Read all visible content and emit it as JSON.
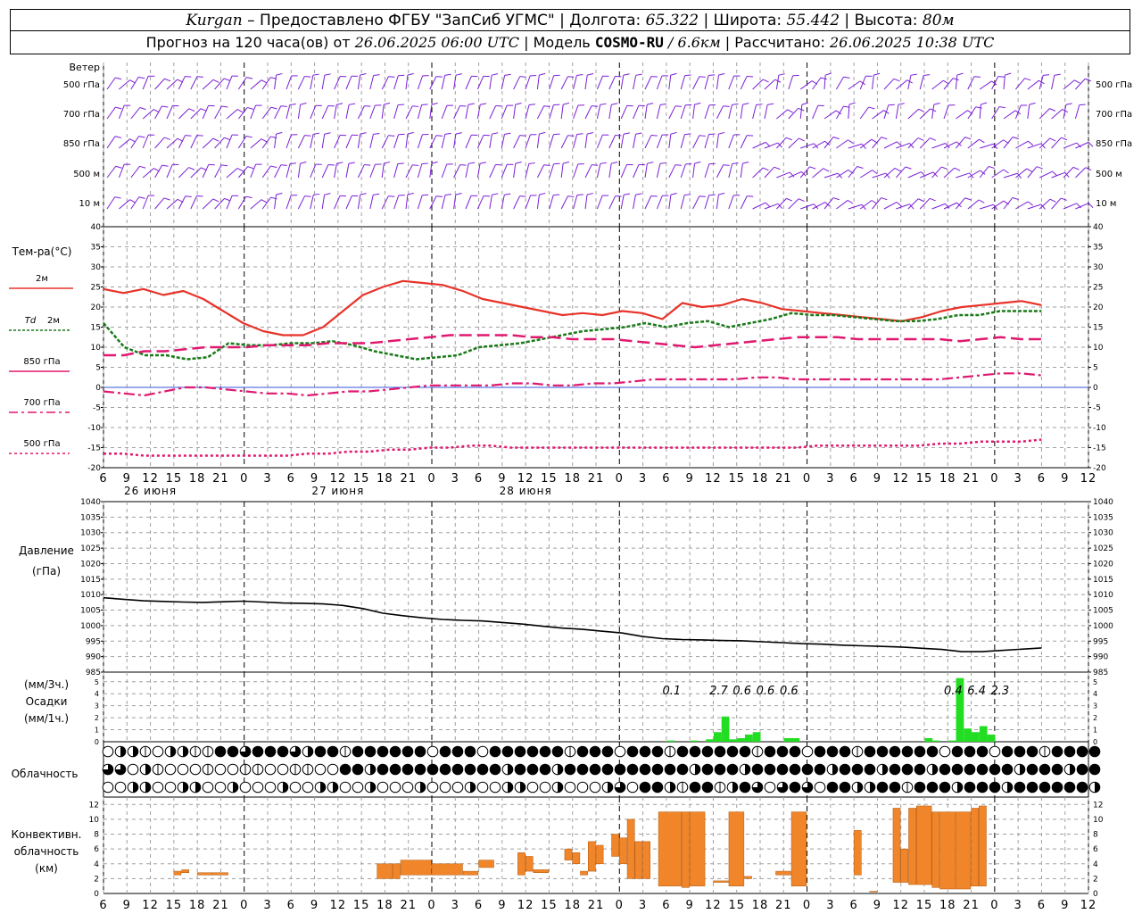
{
  "header": {
    "station": "Kurgan",
    "provider": "– Предоставлено ФГБУ \"ЗапСиб УГМС\"",
    "lon_label": "Долгота:",
    "lon": "65.322",
    "lat_label": "Широта:",
    "lat": "55.442",
    "alt_label": "Высота:",
    "alt": "80м",
    "forecast_prefix": "Прогноз на 120 часа(ов) от",
    "forecast_from": "26.06.2025 06:00 UTC",
    "model_label": "Модель",
    "model": "COSMO-RU",
    "resolution": "/ 6.6км",
    "computed_label": "Рассчитано:",
    "computed": "26.06.2025 10:38 UTC"
  },
  "labels": {
    "wind": "Ветер",
    "wind_levels": [
      "500 гПа",
      "700 гПа",
      "850 гПа",
      "500 м",
      "10 м"
    ],
    "temp": "Тем-ра(°С)",
    "temp_2m": "2м",
    "td_a": "Td",
    "td_b": "2м",
    "t850": "850 гПа",
    "t700": "700 гПа",
    "t500": "500 гПа",
    "pressure": "Давление",
    "pressure_unit": "(гПа)",
    "precip_unit3": "(мм/3ч.)",
    "precip": "Осадки",
    "precip_unit1": "(мм/1ч.)",
    "cloud": "Облачность",
    "conv1": "Конвективн.",
    "conv2": "облачность",
    "conv3": "(км)"
  },
  "colors": {
    "t2m": "#e8332a",
    "td2m": "#1a7a1a",
    "t_upper": "#e0186f",
    "wind": "#7b1fd6",
    "precip": "#22dd22",
    "conv": "#f0852a",
    "pressure": "#000000"
  },
  "chart_data": {
    "type": "line",
    "x_hours": [
      0,
      3,
      6,
      9,
      12,
      15,
      18,
      21,
      24,
      27,
      30,
      33,
      36,
      39,
      42,
      45,
      48,
      51,
      54,
      57,
      60,
      63,
      66,
      69,
      72,
      75,
      78,
      81,
      84,
      87,
      90,
      93,
      96,
      99,
      102,
      105,
      108,
      111,
      114,
      117,
      120
    ],
    "x_tick_labels": [
      "6",
      "9",
      "12",
      "15",
      "18",
      "21",
      "0",
      "3",
      "6",
      "9",
      "12",
      "15",
      "18",
      "21",
      "0",
      "3",
      "6",
      "9",
      "12",
      "15",
      "18",
      "21",
      "0",
      "3",
      "6",
      "9",
      "12",
      "15",
      "18",
      "21",
      "0",
      "3",
      "6",
      "9",
      "12",
      "15",
      "18",
      "21",
      "0",
      "3",
      "6",
      "9",
      "12"
    ],
    "day_labels": [
      {
        "hour": 6,
        "label": "26 июня"
      },
      {
        "hour": 30,
        "label": "27 июня"
      },
      {
        "hour": 54,
        "label": "28 июня"
      }
    ],
    "temperature": {
      "ylim": [
        -20,
        40
      ],
      "ticks": [
        "40",
        "35",
        "30",
        "25",
        "20",
        "15",
        "10",
        "5",
        "0",
        "-5",
        "-10",
        "-15",
        "-20"
      ],
      "series": [
        {
          "name": "2м",
          "values": [
            24.5,
            23.5,
            24.5,
            23,
            24,
            22,
            19,
            16,
            14,
            13,
            13,
            15,
            19,
            23,
            25,
            26.5,
            26,
            25.5,
            24,
            22,
            21,
            20,
            19,
            18,
            18.5,
            18,
            19,
            18.5,
            17,
            21,
            20,
            20.5,
            22,
            21,
            19.5,
            19,
            18.5,
            18,
            17.5,
            17,
            16.5,
            17.5,
            19,
            20,
            20.5,
            21,
            21.5,
            20.5
          ]
        },
        {
          "name": "Td 2м",
          "values": [
            16,
            10,
            8,
            8,
            7,
            7.5,
            11,
            10.5,
            10.5,
            11,
            11,
            11.5,
            10.5,
            9,
            8,
            7,
            7.5,
            8,
            10,
            10.5,
            11,
            12,
            13,
            14,
            14.5,
            15,
            16,
            15,
            16,
            16.5,
            15,
            16,
            17,
            18.5,
            18,
            18,
            17.5,
            17,
            16.5,
            16.5,
            17,
            18,
            18,
            19,
            19,
            19
          ]
        },
        {
          "name": "850 гПа",
          "values": [
            8,
            8,
            9,
            9,
            9.5,
            10,
            10,
            10,
            10.5,
            10.5,
            10.5,
            11,
            11,
            11,
            11.5,
            12,
            12.5,
            13,
            13,
            13,
            13,
            12.5,
            12.5,
            12,
            12,
            12,
            11.5,
            11,
            10.5,
            10,
            10.5,
            11,
            11.5,
            12,
            12.5,
            12.5,
            12.5,
            12,
            12,
            12,
            12,
            12,
            11.5,
            12,
            12.5,
            12,
            12
          ]
        },
        {
          "name": "700 гПа",
          "values": [
            -1,
            -1.5,
            -2,
            -1,
            0,
            0,
            -0.5,
            -1,
            -1.5,
            -1.5,
            -2,
            -1.5,
            -1,
            -1,
            -0.5,
            0,
            0.5,
            0.5,
            0.5,
            0.5,
            1,
            1,
            0.5,
            0.5,
            1,
            1,
            1.5,
            2,
            2,
            2,
            2,
            2,
            2.5,
            2.5,
            2,
            2,
            2,
            2,
            2,
            2,
            2,
            2,
            2.5,
            3,
            3.5,
            3.5,
            3
          ]
        },
        {
          "name": "500 гПа",
          "values": [
            -16.5,
            -16.5,
            -17,
            -17,
            -17,
            -17,
            -17,
            -17,
            -17,
            -17,
            -16.5,
            -16.5,
            -16,
            -16,
            -15.5,
            -15.5,
            -15,
            -15,
            -14.5,
            -14.5,
            -15,
            -15,
            -15,
            -15,
            -15,
            -15,
            -15,
            -15,
            -15,
            -15,
            -15,
            -15,
            -15,
            -15,
            -15,
            -14.5,
            -14.5,
            -14.5,
            -14.5,
            -14.5,
            -14.5,
            -14,
            -14,
            -13.5,
            -13.5,
            -13.5,
            -13
          ]
        }
      ]
    },
    "pressure": {
      "ylim": [
        985,
        1040
      ],
      "ticks": [
        "1040",
        "1035",
        "1030",
        "1025",
        "1020",
        "1015",
        "1010",
        "1005",
        "1000",
        "995",
        "990",
        "985"
      ],
      "values": [
        1009,
        1008.5,
        1008,
        1007.8,
        1007.6,
        1007.5,
        1007.7,
        1007.9,
        1007.6,
        1007.3,
        1007.2,
        1007,
        1006.5,
        1005.5,
        1004,
        1003.2,
        1002.5,
        1002,
        1001.7,
        1001.5,
        1001,
        1000.5,
        999.8,
        999.2,
        998.8,
        998.2,
        997.6,
        996.5,
        995.8,
        995.5,
        995.4,
        995.2,
        995.1,
        994.8,
        994.5,
        994.2,
        994,
        993.7,
        993.5,
        993.3,
        993.1,
        992.7,
        992.3,
        991.6,
        991.6,
        992,
        992.4,
        992.8
      ]
    },
    "precipitation": {
      "ylim": [
        0,
        5
      ],
      "ticks": [
        "5",
        "4",
        "3",
        "2",
        "1",
        "0"
      ],
      "hourly": [
        {
          "hour": 72,
          "value": 0.1
        },
        {
          "hour": 75,
          "value": 0.1
        },
        {
          "hour": 77,
          "value": 0.2
        },
        {
          "hour": 78,
          "value": 0.8
        },
        {
          "hour": 79,
          "value": 2.1
        },
        {
          "hour": 80,
          "value": 0.2
        },
        {
          "hour": 81,
          "value": 0.3
        },
        {
          "hour": 82,
          "value": 0.6
        },
        {
          "hour": 83,
          "value": 0.8
        },
        {
          "hour": 87,
          "value": 0.3
        },
        {
          "hour": 88,
          "value": 0.3
        },
        {
          "hour": 105,
          "value": 0.3
        },
        {
          "hour": 106,
          "value": 0.1
        },
        {
          "hour": 108,
          "value": 0.1
        },
        {
          "hour": 109,
          "value": 5.3
        },
        {
          "hour": 110,
          "value": 1.1
        },
        {
          "hour": 111,
          "value": 0.8
        },
        {
          "hour": 112,
          "value": 1.3
        },
        {
          "hour": 113,
          "value": 0.6
        }
      ],
      "sums_3h": [
        {
          "hour": 72,
          "label": "0.1"
        },
        {
          "hour": 78,
          "label": "2.7"
        },
        {
          "hour": 81,
          "label": "0.6"
        },
        {
          "hour": 84,
          "label": "0.6"
        },
        {
          "hour": 87,
          "label": "0.6"
        },
        {
          "hour": 108,
          "label": "0.4"
        },
        {
          "hour": 111,
          "label": "6.4"
        },
        {
          "hour": 114,
          "label": "2.3"
        }
      ]
    },
    "convective": {
      "ylim": [
        0,
        13
      ],
      "ticks": [
        "12",
        "10",
        "8",
        "6",
        "4",
        "2",
        "0"
      ],
      "bars": [
        [
          9,
          10,
          2.5,
          3
        ],
        [
          10,
          11,
          2.8,
          3.2
        ],
        [
          12,
          14,
          2.5,
          2.8
        ],
        [
          14,
          16,
          2.5,
          2.8
        ],
        [
          35,
          37,
          2,
          4
        ],
        [
          37,
          38,
          2,
          4
        ],
        [
          38,
          42,
          2.5,
          4.5
        ],
        [
          42,
          46,
          2.5,
          4
        ],
        [
          46,
          48,
          2.5,
          3
        ],
        [
          48,
          50,
          3.5,
          4.5
        ],
        [
          53,
          54,
          2.5,
          5.5
        ],
        [
          54,
          55,
          3,
          5
        ],
        [
          55,
          57,
          2.8,
          3.2
        ],
        [
          59,
          60,
          4.5,
          6
        ],
        [
          60,
          61,
          4,
          5.5
        ],
        [
          61,
          62,
          2.5,
          3
        ],
        [
          62,
          63,
          3,
          7
        ],
        [
          63,
          64,
          4,
          6.5
        ],
        [
          65,
          66,
          5,
          8
        ],
        [
          66,
          67,
          4,
          7.5
        ],
        [
          67,
          68,
          2,
          10
        ],
        [
          68,
          69,
          2,
          7
        ],
        [
          69,
          70,
          2,
          7
        ],
        [
          71,
          74,
          1,
          11
        ],
        [
          74,
          75,
          0.8,
          11
        ],
        [
          75,
          77,
          1,
          11
        ],
        [
          78,
          80,
          1.5,
          1.7
        ],
        [
          80,
          82,
          1,
          11
        ],
        [
          82,
          83,
          2,
          2.3
        ],
        [
          86,
          88,
          2.5,
          3
        ],
        [
          88,
          90,
          1,
          11
        ],
        [
          96,
          97,
          2.5,
          8.5
        ],
        [
          98,
          99,
          0.2,
          0.3
        ],
        [
          101,
          102,
          1.5,
          11.5
        ],
        [
          102,
          103,
          1.5,
          6
        ],
        [
          103,
          104,
          1.2,
          11.5
        ],
        [
          104,
          106,
          1.2,
          11.8
        ],
        [
          106,
          107,
          0.8,
          11
        ],
        [
          107,
          109,
          0.6,
          11
        ],
        [
          109,
          111,
          0.6,
          11
        ],
        [
          111,
          112,
          1,
          11.5
        ],
        [
          112,
          113,
          1,
          11.8
        ]
      ]
    }
  }
}
